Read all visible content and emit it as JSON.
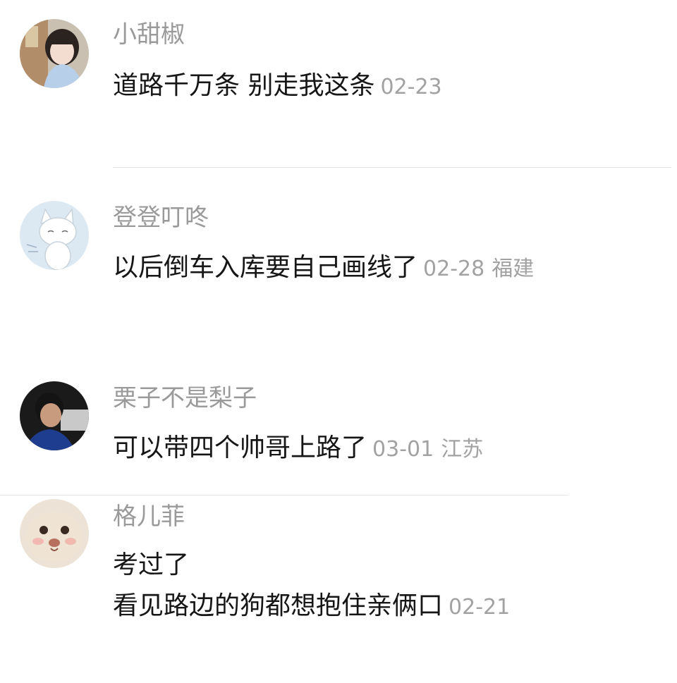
{
  "comments": [
    {
      "username": "小甜椒",
      "lines": [
        "道路千万条 别走我这条"
      ],
      "date": "02-23",
      "location": ""
    },
    {
      "username": "登登叮咚",
      "lines": [
        "以后倒车入库要自己画线了"
      ],
      "date": "02-28",
      "location": "福建"
    },
    {
      "username": "栗子不是梨子",
      "lines": [
        "可以带四个帅哥上路了"
      ],
      "date": "03-01",
      "location": "江苏"
    },
    {
      "username": "格儿菲",
      "lines": [
        "考过了",
        "看见路边的狗都想抱住亲俩口"
      ],
      "date": "02-21",
      "location": ""
    }
  ],
  "colors": {
    "username": "#9a9a9a",
    "text": "#161616",
    "meta": "#a2a2a2",
    "divider": "#e6e6e6"
  }
}
